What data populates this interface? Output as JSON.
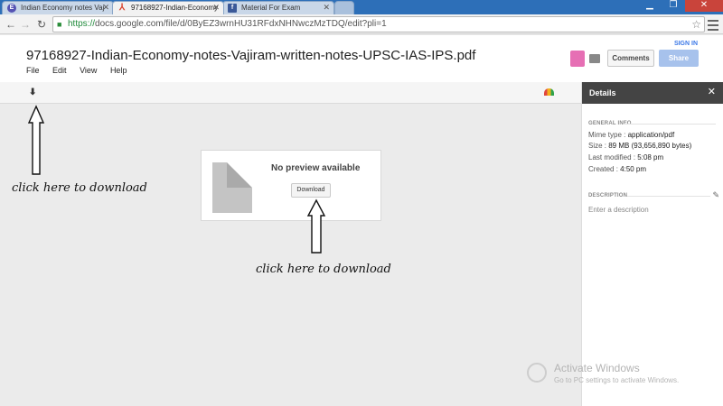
{
  "browser": {
    "tabs": [
      {
        "title": "Indian Economy notes Vaj",
        "icon": "e-icon",
        "color": "#5553b3"
      },
      {
        "title": "97168927-Indian-Economy",
        "icon": "pdf-icon",
        "color": "#d9412b"
      },
      {
        "title": "Material For Exam",
        "icon": "facebook-icon",
        "color": "#3b5998"
      }
    ],
    "url_scheme": "https://",
    "url_rest": "docs.google.com/file/d/0ByEZ3wrnHU31RFdxNHNwczMzTDQ/edit?pli=1"
  },
  "doc": {
    "title": "97168927-Indian-Economy-notes-Vajiram-written-notes-UPSC-IAS-IPS.pdf",
    "menu": [
      "File",
      "Edit",
      "View",
      "Help"
    ],
    "signin": "SIGN IN",
    "comments": "Comments",
    "share": "Share"
  },
  "viewer": {
    "no_preview": "No preview available",
    "download": "Download"
  },
  "annotations": [
    "click here to download",
    "click here to download"
  ],
  "details": {
    "title": "Details",
    "general_info": "GENERAL INFO",
    "mime_label": "Mime type",
    "mime_value": "application/pdf",
    "size_label": "Size",
    "size_value": "89 MB (93,656,890 bytes)",
    "modified_label": "Last modified",
    "modified_value": "5:08 pm",
    "created_label": "Created",
    "created_value": "4:50 pm",
    "description": "DESCRIPTION",
    "description_placeholder": "Enter a description"
  },
  "watermark": {
    "title": "Activate Windows",
    "subtitle": "Go to PC settings to activate Windows."
  },
  "colors": {
    "accent": "#3b78e7",
    "share_button": "#a7c2ec",
    "details_header": "#444444"
  }
}
